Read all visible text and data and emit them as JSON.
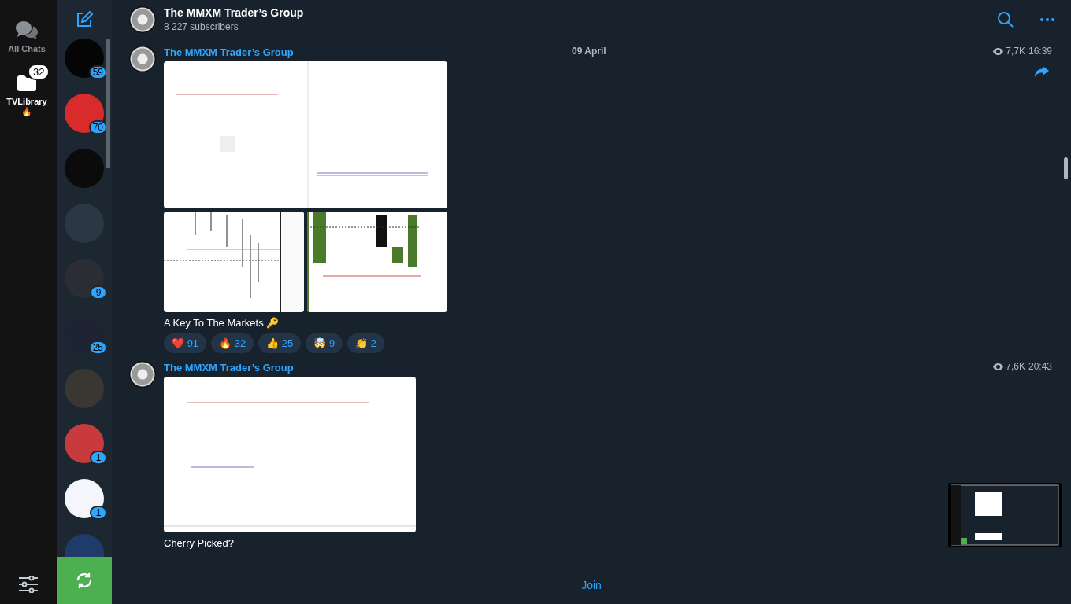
{
  "folders": [
    {
      "label": "All Chats",
      "selected": false,
      "kind": "chats"
    },
    {
      "label": "TVLibrary 🔥",
      "selected": true,
      "kind": "folder",
      "badge": "32"
    }
  ],
  "chats": [
    {
      "color": "#050505",
      "badge": "59"
    },
    {
      "color": "#d92b2b",
      "badge": "70"
    },
    {
      "color": "#0b0b0b"
    },
    {
      "color": "#2b3744"
    },
    {
      "color": "#2a2d33",
      "badge": "9"
    },
    {
      "color": "#1e2433",
      "badge": "25"
    },
    {
      "color": "#3a3733"
    },
    {
      "color": "#c93a3e",
      "badge": "1"
    },
    {
      "color": "#f4f6fb",
      "badge": "1"
    },
    {
      "color": "#1f3b6a"
    }
  ],
  "header": {
    "title": "The MMXM Trader’s Group",
    "subtitle": "8 227 subscribers"
  },
  "date_separator": "09 April",
  "messages": [
    {
      "author": "The MMXM Trader’s Group",
      "views": "7,7K",
      "time": "16:39",
      "kind": "album",
      "caption": "A Key To The Markets 🔑",
      "forward": true,
      "reactions": [
        {
          "emoji": "❤️",
          "count": "91"
        },
        {
          "emoji": "🔥",
          "count": "32"
        },
        {
          "emoji": "👍",
          "count": "25"
        },
        {
          "emoji": "🤯",
          "count": "9"
        },
        {
          "emoji": "👏",
          "count": "2"
        }
      ]
    },
    {
      "author": "The MMXM Trader’s Group",
      "views": "7,6K",
      "time": "20:43",
      "kind": "single",
      "caption": "Cherry Picked?",
      "forward": false
    }
  ],
  "join_button": "Join"
}
